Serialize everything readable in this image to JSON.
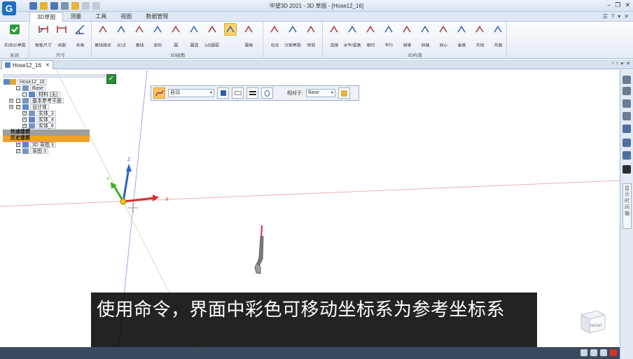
{
  "window": {
    "title": "中望3D 2021 - 3D 草图 - [Hose12_16]",
    "logo": "G"
  },
  "menu": {
    "tabs": [
      "3D草图",
      "测量",
      "工具",
      "视图",
      "数据管理"
    ],
    "active": 0
  },
  "ribbon": {
    "groups": [
      {
        "title": "关闭",
        "buttons": [
          {
            "label": "关闭3D草图",
            "icon": "check-exit-icon"
          }
        ]
      },
      {
        "title": "尺寸",
        "buttons": [
          {
            "label": "智能尺寸",
            "icon": "smart-dim-icon"
          },
          {
            "label": "间距",
            "icon": "distance-icon"
          },
          {
            "label": "夹角",
            "icon": "angle-icon"
          }
        ]
      },
      {
        "title": "3D绘图",
        "buttons": [
          {
            "label": "管线路径",
            "icon": "pipe-path-icon"
          },
          {
            "label": "3D点",
            "icon": "point-icon"
          },
          {
            "label": "直线",
            "icon": "line-icon"
          },
          {
            "label": "矩形",
            "icon": "rect-icon"
          },
          {
            "label": "圆",
            "icon": "circle-icon"
          },
          {
            "label": "圆弧",
            "icon": "arc-icon"
          },
          {
            "label": "3点圆弧",
            "icon": "arc3-icon"
          },
          {
            "label": "",
            "icon": "spline-icon",
            "active": true
          },
          {
            "label": "圆角",
            "icon": "fillet-icon"
          }
        ]
      },
      {
        "title": "",
        "buttons": [
          {
            "label": "包含",
            "icon": "include-icon"
          },
          {
            "label": "分割草图",
            "icon": "split-icon"
          },
          {
            "label": "修剪",
            "icon": "trim-icon"
          }
        ]
      },
      {
        "title": "3D约束",
        "buttons": [
          {
            "label": "连接",
            "icon": "connect-icon"
          },
          {
            "label": "水平/竖直",
            "icon": "hv-icon"
          },
          {
            "label": "相切",
            "icon": "tangent-icon"
          },
          {
            "label": "平行",
            "icon": "parallel-icon"
          },
          {
            "label": "相等",
            "icon": "equal-icon"
          },
          {
            "label": "同轴",
            "icon": "coaxial-icon"
          },
          {
            "label": "同心",
            "icon": "concentric-icon"
          },
          {
            "label": "垂直",
            "icon": "perp-icon"
          },
          {
            "label": "共线",
            "icon": "collinear-icon"
          },
          {
            "label": "共面",
            "icon": "coplanar-icon"
          }
        ]
      }
    ]
  },
  "doc_tab": {
    "label": "Hose12_16"
  },
  "tree": {
    "root": "Hose12_16",
    "nodes": [
      {
        "label": "Base",
        "indent": 1,
        "chk": false,
        "exp": false
      },
      {
        "label": "材料 (无)",
        "indent": 2,
        "chk": false,
        "exp": false
      },
      {
        "label": "基本参考平面",
        "indent": 1,
        "chk": false,
        "exp": true
      },
      {
        "label": "设计体",
        "indent": 1,
        "chk": true,
        "exp": true
      },
      {
        "label": "实体_3",
        "indent": 2,
        "chk": true,
        "exp": false
      },
      {
        "label": "实体_4",
        "indent": 2,
        "chk": true,
        "exp": false
      },
      {
        "label": "实体_6",
        "indent": 2,
        "chk": true,
        "exp": false
      },
      {
        "label": "快速建模",
        "indent": 0,
        "bar": "gray"
      },
      {
        "label": "历史建模",
        "indent": 0,
        "bar": "orange"
      },
      {
        "label": "3D 草图 3",
        "indent": 1,
        "chk": true,
        "exp": false
      },
      {
        "label": "草图 3",
        "indent": 1,
        "chk": true,
        "exp": false
      }
    ]
  },
  "float_toolbar": {
    "mode_value": "自动",
    "relative_label": "相对于:",
    "relative_value": "Base"
  },
  "axes": {
    "z": "Z",
    "y": "Y",
    "x": "X"
  },
  "subtitle": "使用命令，界面中彩色可移动坐标系为参考坐标系",
  "viewcube": {
    "label": "FRONT"
  },
  "status": {
    "text": ""
  },
  "right_rail": {
    "vertical_label": "显示时间轴"
  }
}
